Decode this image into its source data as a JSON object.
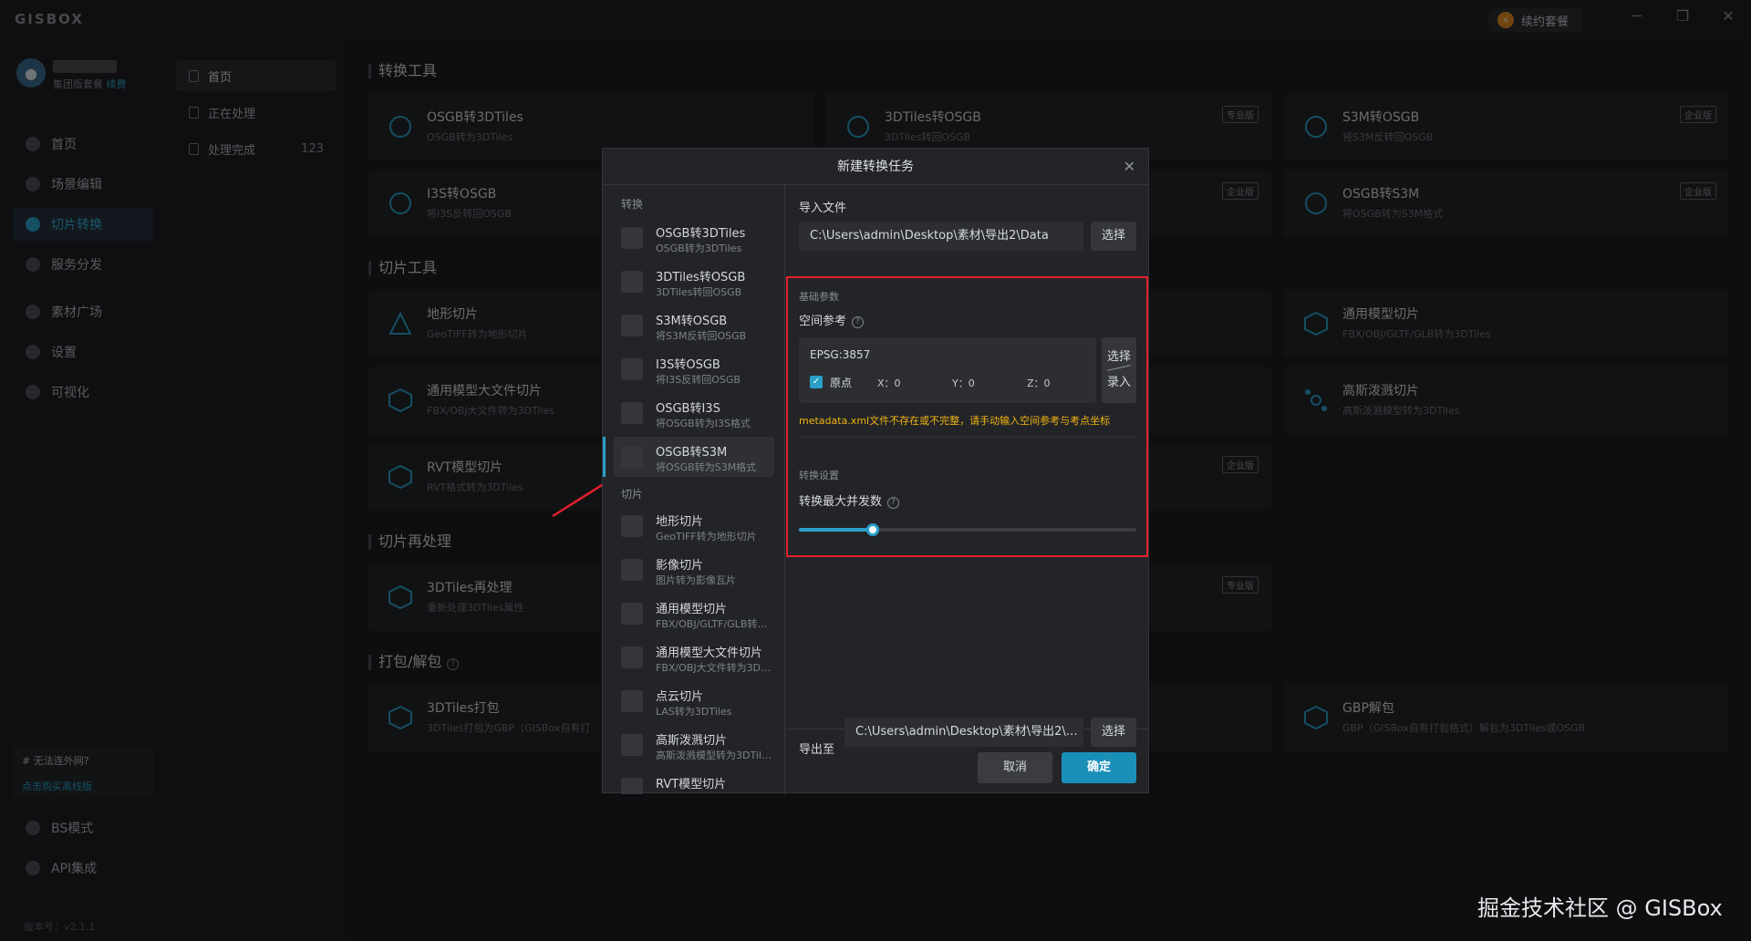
{
  "app": {
    "brand": "GISBOX",
    "renew_label": "续约套餐",
    "minimize": "─",
    "restore": "❐",
    "close": "✕"
  },
  "user": {
    "tier": "集团版套餐",
    "renew_link": "续费"
  },
  "leftnav": {
    "items": [
      {
        "label": "首页"
      },
      {
        "label": "场景编辑"
      },
      {
        "label": "切片转换"
      },
      {
        "label": "服务分发"
      },
      {
        "label": "素材广场"
      },
      {
        "label": "设置"
      },
      {
        "label": "可视化"
      },
      {
        "label": "BS模式"
      },
      {
        "label": "API集成"
      }
    ],
    "promo_title": "# 无法连外网?",
    "promo_link": "点击购买离线版",
    "version": "版本号：v2.1.1"
  },
  "subnav": {
    "items": [
      {
        "label": "首页"
      },
      {
        "label": "正在处理"
      },
      {
        "label": "处理完成",
        "count": "123"
      }
    ]
  },
  "main": {
    "sections": {
      "convert": "转换工具",
      "slice": "切片工具",
      "reprocess": "切片再处理",
      "pack": "打包/解包"
    },
    "cards": [
      {
        "title": "OSGB转3DTiles",
        "sub": "OSGB转为3DTiles"
      },
      {
        "title": "3DTiles转OSGB",
        "sub": "3DTiles转回OSGB",
        "tag": "专业版"
      },
      {
        "title": "S3M转OSGB",
        "sub": "将S3M反转回OSGB",
        "tag": "企业版"
      },
      {
        "title": "I3S转OSGB",
        "sub": "将I3S反转回OSGB"
      },
      {
        "title": "OSGB转S3M",
        "sub": "将OSGB转为S3M格式",
        "tag": "企业版"
      },
      {
        "title": "地形切片",
        "sub": "GeoTIFF转为地形切片"
      },
      {
        "title": "通用模型切片",
        "sub": "FBX/OBJ/GLTF/GLB转为3DTiles"
      },
      {
        "title": "通用模型大文件切片",
        "sub": "FBX/OBJ大文件转为3DTiles"
      },
      {
        "title": "高斯泼溅切片",
        "sub": "高斯泼溅模型转为3DTiles"
      },
      {
        "title": "RVT模型切片",
        "sub": "RVT格式转为3DTiles"
      },
      {
        "title": "3DTiles再处理",
        "sub": "重新处理3DTiles属性"
      },
      {
        "title": "3DTiles打包",
        "sub": "3DTiles打包为GBP（GISBox自有打"
      },
      {
        "title": "GBP解包",
        "sub": "GBP（GISBox自有打包格式）解包为3DTiles或OSGB"
      }
    ],
    "hidden_tags": {
      "t1": "企业版",
      "t2": "企业版",
      "t3": "专业版"
    }
  },
  "modal": {
    "title": "新建转换任务",
    "close": "✕",
    "groups": {
      "convert": "转换",
      "slice": "切片"
    },
    "items": [
      {
        "title": "OSGB转3DTiles",
        "sub": "OSGB转为3DTiles"
      },
      {
        "title": "3DTiles转OSGB",
        "sub": "3DTiles转回OSGB"
      },
      {
        "title": "S3M转OSGB",
        "sub": "将S3M反转回OSGB"
      },
      {
        "title": "I3S转OSGB",
        "sub": "将I3S反转回OSGB"
      },
      {
        "title": "OSGB转I3S",
        "sub": "将OSGB转为I3S格式"
      },
      {
        "title": "OSGB转S3M",
        "sub": "将OSGB转为S3M格式"
      },
      {
        "title": "地形切片",
        "sub": "GeoTIFF转为地形切片"
      },
      {
        "title": "影像切片",
        "sub": "图片转为影像瓦片"
      },
      {
        "title": "通用模型切片",
        "sub": "FBX/OBJ/GLTF/GLB转为3DTiles"
      },
      {
        "title": "通用模型大文件切片",
        "sub": "FBX/OBJ大文件转为3DTiles"
      },
      {
        "title": "点云切片",
        "sub": "LAS转为3DTiles"
      },
      {
        "title": "高斯泼溅切片",
        "sub": "高斯泼溅模型转为3DTiles"
      },
      {
        "title": "RVT模型切片",
        "sub": ""
      }
    ],
    "import_label": "导入文件",
    "import_path": "C:\\Users\\admin\\Desktop\\素材\\导出2\\Data",
    "select_label": "选择",
    "basic_params": "基础参数",
    "spatial_ref_label": "空间参考",
    "epsg": "EPSG:3857",
    "origin_label": "原点",
    "x": "X：0",
    "y": "Y：0",
    "z": "Z：0",
    "select_btn": "选择",
    "input_btn": "录入",
    "warning": "metadata.xml文件不存在或不完整，请手动输入空间参考与考点坐标",
    "convert_settings": "转换设置",
    "concurrency_label": "转换最大并发数",
    "concurrency_fraction": 0.22,
    "export_label": "导出至",
    "export_path": "C:\\Users\\admin\\Desktop\\素材\\导出2\\osgb",
    "cancel": "取消",
    "ok": "确定"
  },
  "watermark": "掘金技术社区 @ GISBox"
}
